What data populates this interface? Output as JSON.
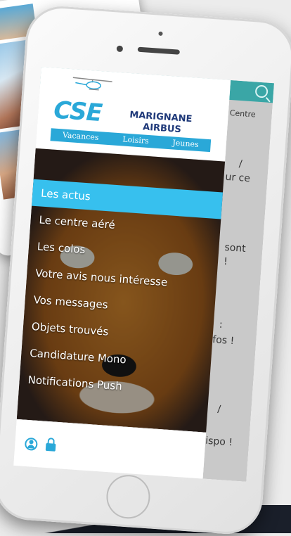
{
  "logo": {
    "initials": "CSE",
    "line1": "MARIGNANE",
    "line2": "AIRBUS",
    "tagline": [
      "Vacances",
      "Loisirs",
      "Jeunes"
    ]
  },
  "menu": {
    "items": [
      {
        "label": "Les actus",
        "active": true
      },
      {
        "label": "Le centre aéré",
        "active": false
      },
      {
        "label": "Les colos",
        "active": false
      },
      {
        "label": "Votre avis nous intéresse",
        "active": false
      },
      {
        "label": "Vos messages",
        "active": false
      },
      {
        "label": "Objets trouvés",
        "active": false
      },
      {
        "label": "Candidature Mono",
        "active": false
      },
      {
        "label": "Notifications Push",
        "active": false
      }
    ]
  },
  "behind": {
    "lines": [
      "Centre",
      "/",
      "ur ce",
      "sont",
      "!",
      ":",
      "fos !",
      "/",
      "ispo !"
    ]
  },
  "footer": {
    "icons": [
      "user-icon",
      "lock-icon"
    ]
  },
  "colors": {
    "accent": "#37c0ee",
    "header": "#3aa6a6",
    "brand": "#203a7a"
  }
}
